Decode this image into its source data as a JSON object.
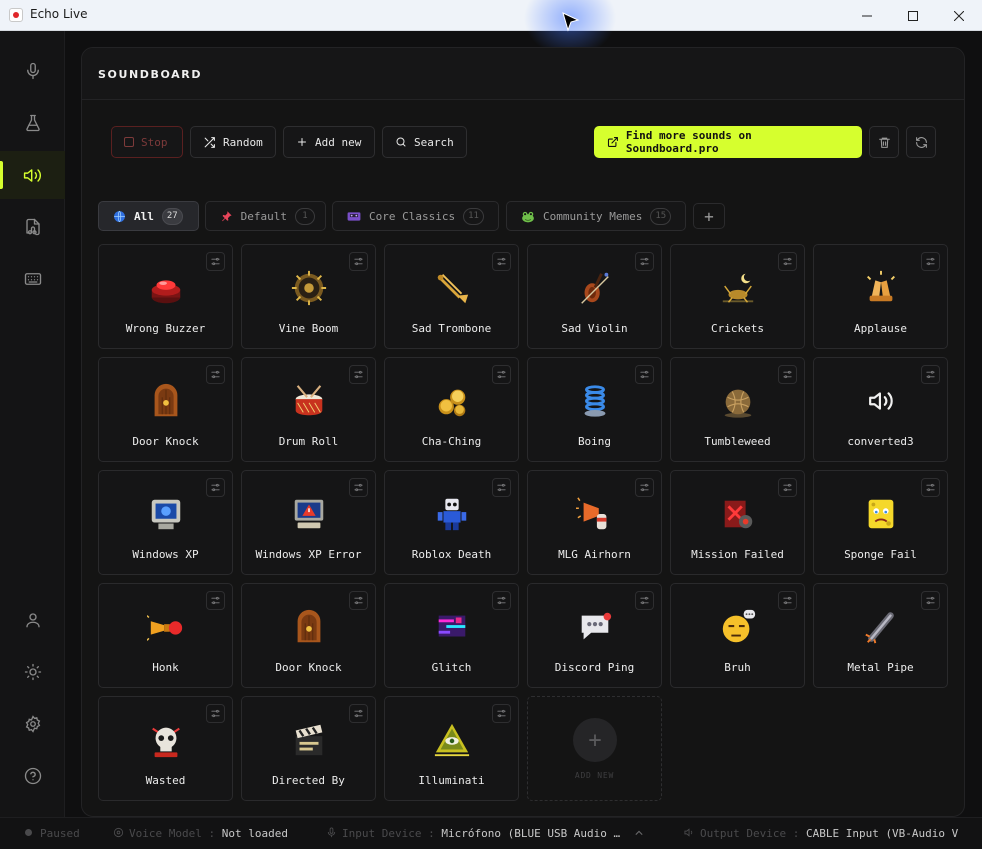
{
  "window": {
    "title": "Echo Live"
  },
  "panel": {
    "title": "SOUNDBOARD"
  },
  "toolbar": {
    "stop": "Stop",
    "random": "Random",
    "add_new": "Add new",
    "search": "Search",
    "find_more": "Find more sounds on Soundboard.pro"
  },
  "tabs": [
    {
      "label": "All",
      "count": "27",
      "icon": "globe-icon"
    },
    {
      "label": "Default",
      "count": "1",
      "icon": "pushpin-icon"
    },
    {
      "label": "Core Classics",
      "count": "11",
      "icon": "cassette-icon"
    },
    {
      "label": "Community Memes",
      "count": "15",
      "icon": "frog-icon"
    }
  ],
  "sounds": [
    {
      "label": "Wrong Buzzer",
      "icon": "red-buzzer-icon"
    },
    {
      "label": "Vine Boom",
      "icon": "vine-boom-icon"
    },
    {
      "label": "Sad Trombone",
      "icon": "trombone-icon"
    },
    {
      "label": "Sad Violin",
      "icon": "violin-icon"
    },
    {
      "label": "Crickets",
      "icon": "crickets-icon"
    },
    {
      "label": "Applause",
      "icon": "clapping-hands-icon"
    },
    {
      "label": "Door Knock",
      "icon": "wooden-door-icon"
    },
    {
      "label": "Drum Roll",
      "icon": "drum-icon"
    },
    {
      "label": "Cha-Ching",
      "icon": "coins-icon"
    },
    {
      "label": "Boing",
      "icon": "spring-icon"
    },
    {
      "label": "Tumbleweed",
      "icon": "tumbleweed-icon"
    },
    {
      "label": "converted3",
      "icon": "speaker-icon"
    },
    {
      "label": "Windows XP",
      "icon": "crt-monitor-icon"
    },
    {
      "label": "Windows XP Error",
      "icon": "error-monitor-icon"
    },
    {
      "label": "Roblox Death",
      "icon": "robot-icon"
    },
    {
      "label": "MLG Airhorn",
      "icon": "airhorn-icon"
    },
    {
      "label": "Mission Failed",
      "icon": "mission-failed-icon"
    },
    {
      "label": "Sponge Fail",
      "icon": "sponge-icon"
    },
    {
      "label": "Honk",
      "icon": "horn-icon"
    },
    {
      "label": "Door Knock",
      "icon": "wooden-door-icon"
    },
    {
      "label": "Glitch",
      "icon": "glitch-icon"
    },
    {
      "label": "Discord Ping",
      "icon": "chat-bubble-icon"
    },
    {
      "label": "Bruh",
      "icon": "unamused-face-icon"
    },
    {
      "label": "Metal Pipe",
      "icon": "metal-pipe-icon"
    },
    {
      "label": "Wasted",
      "icon": "skull-icon"
    },
    {
      "label": "Directed By",
      "icon": "clapperboard-icon"
    },
    {
      "label": "Illuminati",
      "icon": "illuminati-icon"
    }
  ],
  "add_card": {
    "label": "ADD NEW"
  },
  "status": {
    "state": "Paused",
    "voice_model_label": "Voice Model",
    "voice_model_value": "Not loaded",
    "input_label": "Input Device",
    "input_value": "Micrófono (BLUE USB Audio …",
    "output_label": "Output Device",
    "output_value": "CABLE Input (VB-Audio V"
  },
  "colors": {
    "accent": "#d6ff2e",
    "background": "#0f0f10",
    "panel": "#141414",
    "stop_border": "#5a2020"
  }
}
